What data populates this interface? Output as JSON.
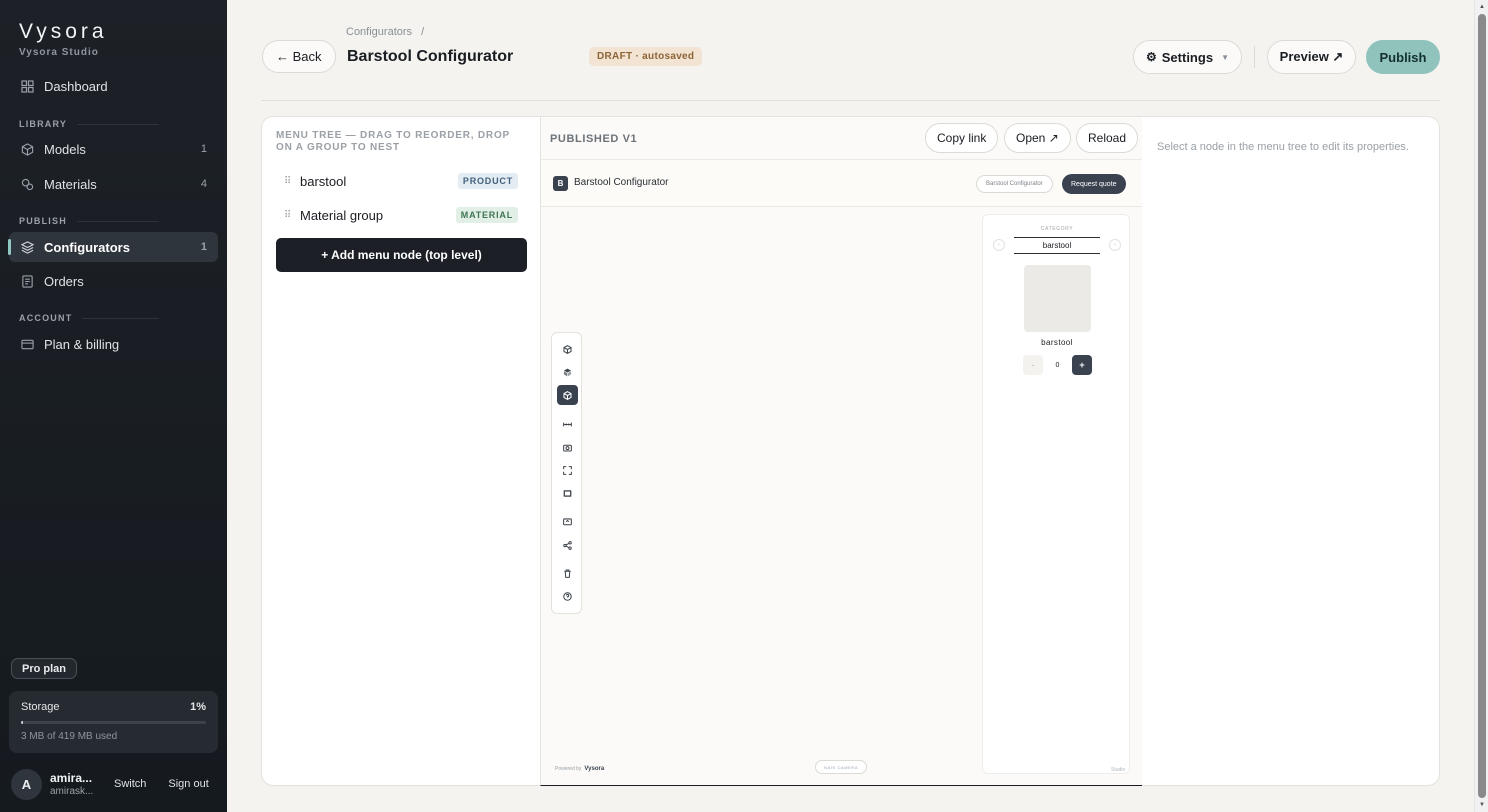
{
  "sidebar": {
    "brand": "Vysora",
    "brand_sub": "Vysora Studio",
    "dashboard": {
      "label": "Dashboard",
      "icon": "grid-icon"
    },
    "library_label": "LIBRARY",
    "models": {
      "label": "Models",
      "count": "1",
      "icon": "cube-icon"
    },
    "materials": {
      "label": "Materials",
      "count": "4",
      "icon": "materials-icon"
    },
    "publish_label": "PUBLISH",
    "configurators": {
      "label": "Configurators",
      "count": "1",
      "icon": "layers-icon"
    },
    "orders": {
      "label": "Orders",
      "icon": "receipt-icon"
    },
    "account_label": "ACCOUNT",
    "billing": {
      "label": "Plan & billing",
      "icon": "card-icon"
    },
    "plan_badge": "Pro plan",
    "storage": {
      "label": "Storage",
      "percent": "1%",
      "fraction": 0.01,
      "used": "3 MB of 419 MB used"
    },
    "user": {
      "initial": "A",
      "name": "amira...",
      "email": "amirask...",
      "switch": "Switch",
      "signout": "Sign out"
    }
  },
  "header": {
    "breadcrumb": "Configurators",
    "breadcrumb_sep": "/",
    "back": "← Back",
    "title": "Barstool Configurator",
    "status": "DRAFT · autosaved",
    "settings": "Settings",
    "preview": "Preview ↗",
    "publish": "Publish"
  },
  "tree": {
    "title": "MENU TREE — DRAG TO REORDER, DROP ON A GROUP TO NEST",
    "nodes": [
      {
        "label": "barstool",
        "tag": "PRODUCT"
      },
      {
        "label": "Material group",
        "tag": "MATERIAL"
      }
    ],
    "add": "+ Add menu node (top level)"
  },
  "preview": {
    "label": "PUBLISHED V1",
    "copy": "Copy link",
    "open": "Open ↗",
    "reload": "Reload",
    "embed": {
      "logo": "B",
      "title": "Barstool Configurator",
      "chip": "Barstool Configurator",
      "quote": "Request quote",
      "category_label": "CATEGORY",
      "category_value": "barstool",
      "prev": "‹",
      "next": "›",
      "item_label": "barstool",
      "minus": "-",
      "qty": "0",
      "plus": "+",
      "powered_prefix": "Powered by",
      "powered_brand": "Vysora",
      "camera": "NAIS CAMERA",
      "studio": "Studio"
    }
  },
  "props": {
    "hint": "Select a node in the menu tree to edit its properties."
  }
}
